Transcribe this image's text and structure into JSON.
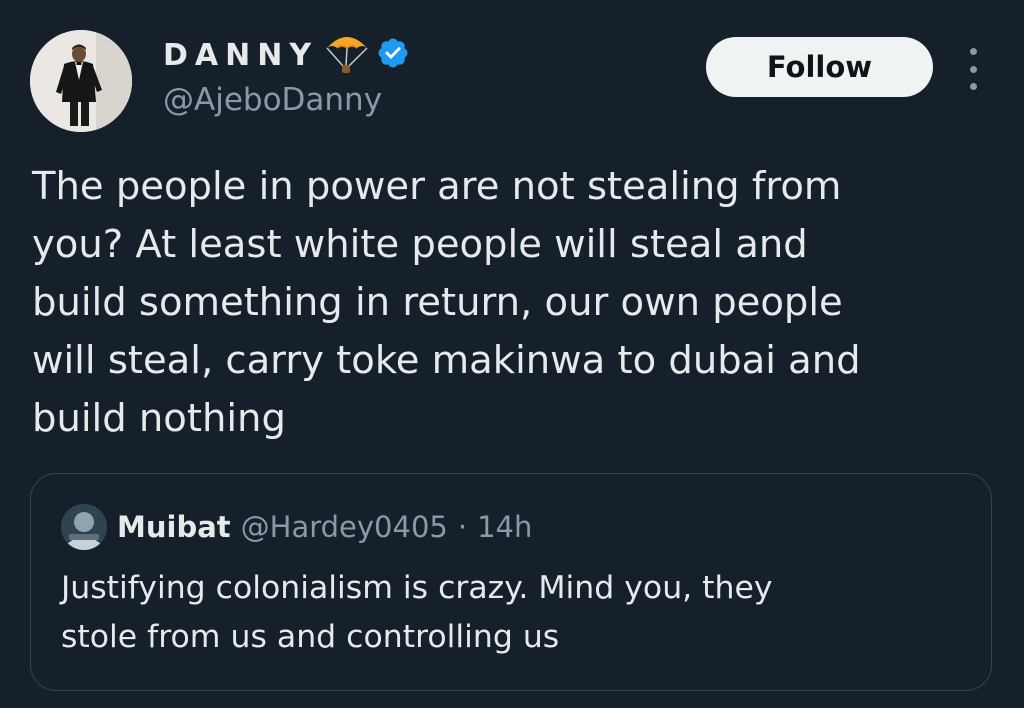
{
  "author": {
    "display_name": "DANNY",
    "handle": "@AjeboDanny",
    "verified": true,
    "name_emoji": "parachute-icon",
    "avatar": "avatar-man-in-tuxedo"
  },
  "actions": {
    "follow_label": "Follow",
    "more": "more-options-icon"
  },
  "tweet": {
    "text": "The people in power are not stealing from\nyou? At least white people will steal and\nbuild something in return, our own people\nwill steal, carry toke makinwa to dubai and\nbuild nothing"
  },
  "quoted_tweet": {
    "display_name": "Muibat",
    "handle": "@Hardey0405",
    "separator": "·",
    "time": "14h",
    "text": "Justifying colonialism is crazy. Mind you, they\nstole from us and controlling us"
  },
  "colors": {
    "background": "#15202b",
    "text_primary": "#e7e9ea",
    "text_secondary": "#8b98a5",
    "verified_blue": "#1d9bf0",
    "border": "#38444d",
    "follow_bg": "#eff3f4"
  }
}
